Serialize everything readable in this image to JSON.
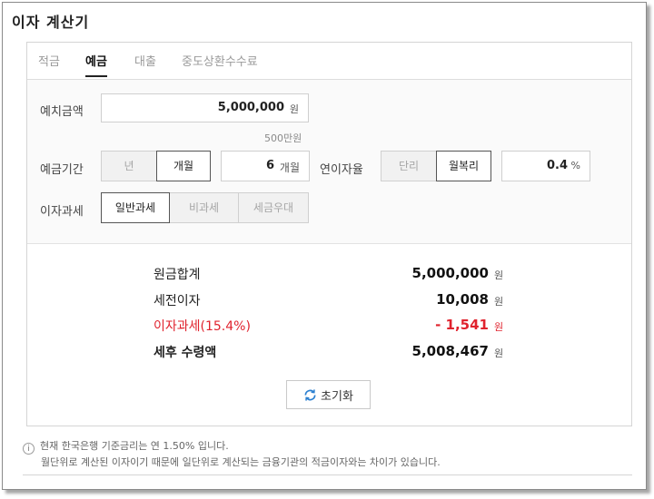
{
  "title": "이자 계산기",
  "tabs": [
    {
      "label": "적금"
    },
    {
      "label": "예금"
    },
    {
      "label": "대출"
    },
    {
      "label": "중도상환수수료"
    }
  ],
  "form": {
    "deposit": {
      "label": "예치금액",
      "value": "5,000,000",
      "unit": "원",
      "hint": "500만원"
    },
    "period": {
      "label": "예금기간",
      "options": [
        "년",
        "개월"
      ],
      "selected": "개월",
      "value": "6",
      "unit": "개월"
    },
    "rate": {
      "label": "연이자율",
      "options": [
        "단리",
        "월복리"
      ],
      "selected": "월복리",
      "value": "0.4",
      "unit": "%"
    },
    "tax": {
      "label": "이자과세",
      "options": [
        "일반과세",
        "비과세",
        "세금우대"
      ],
      "selected": "일반과세"
    }
  },
  "results": {
    "principal": {
      "label": "원금합계",
      "value": "5,000,000",
      "unit": "원"
    },
    "pretax_interest": {
      "label": "세전이자",
      "value": "10,008",
      "unit": "원"
    },
    "tax": {
      "label": "이자과세(15.4%)",
      "value": "- 1,541",
      "unit": "원"
    },
    "net": {
      "label": "세후 수령액",
      "value": "5,008,467",
      "unit": "원"
    }
  },
  "reset_label": "초기화",
  "notes": [
    "현재 한국은행 기준금리는 연 1.50% 입니다.",
    "월단위로 계산된 이자이기 때문에 일단위로 계산되는 금융기관의 적금이자와는 차이가 있습니다."
  ],
  "colors": {
    "accent_red": "#e0232e",
    "reset_icon": "#2a7fd0"
  }
}
